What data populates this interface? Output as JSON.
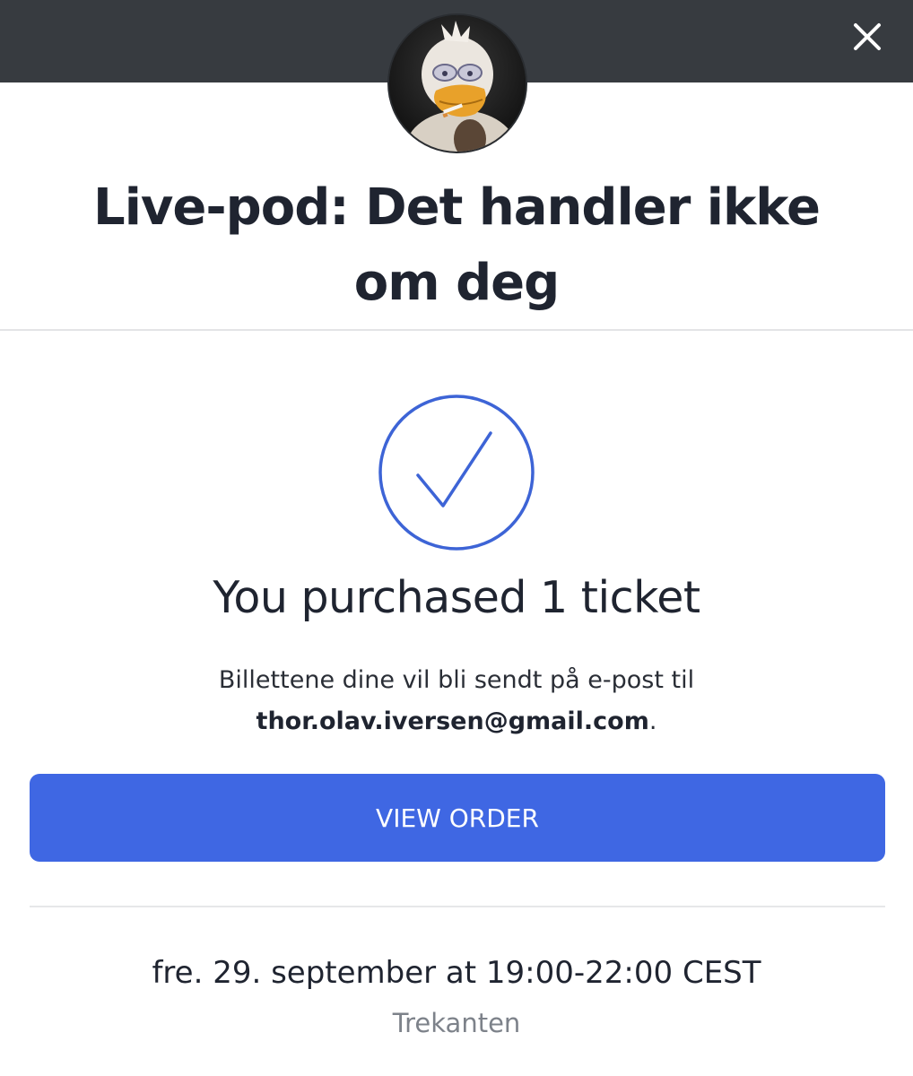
{
  "header": {
    "close_icon": "close-icon",
    "avatar_icon": "duck-avatar"
  },
  "event": {
    "title": "Live-pod: Det handler ikke om deg"
  },
  "confirmation": {
    "check_icon": "checkmark-circle-icon",
    "headline": "You purchased 1 ticket",
    "email_prefix": "Billettene dine vil bli sendt på e-post til",
    "email": "thor.olav.iversen@gmail.com",
    "email_suffix": "."
  },
  "actions": {
    "view_order_label": "VIEW ORDER"
  },
  "details": {
    "datetime": "fre. 29. september at 19:00-22:00 CEST",
    "venue": "Trekanten"
  },
  "colors": {
    "topbar": "#373b40",
    "accent": "#3f67e3",
    "check": "#3d64d6",
    "muted_text": "#7d828a"
  }
}
